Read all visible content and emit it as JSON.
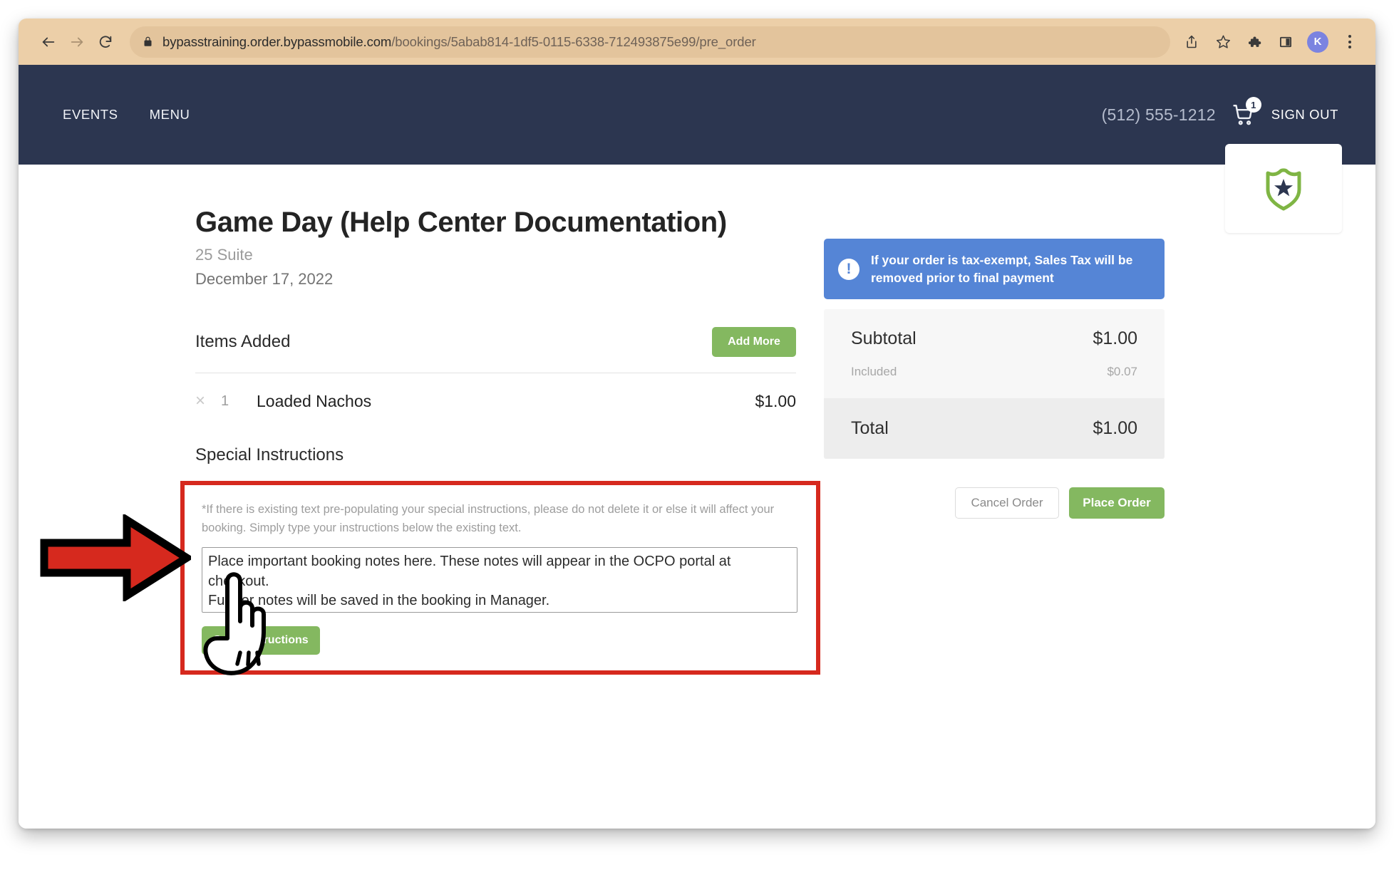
{
  "browser": {
    "url_secure_part": "bypasstraining.order.bypassmobile.com",
    "url_path": "/bookings/5abab814-1df5-0115-6338-712493875e99/pre_order",
    "back_label": "←",
    "forward_label": "→",
    "reload_label": "↻",
    "profile_initial": "K",
    "icons": {
      "lock": "lock-icon",
      "share": "share-icon",
      "bookmark": "star-icon",
      "extensions": "puzzle-icon",
      "sidebar": "sidebar-icon",
      "menu": "kebab-menu-icon"
    }
  },
  "site_header": {
    "nav": [
      {
        "label": "EVENTS"
      },
      {
        "label": "MENU"
      }
    ],
    "phone": "(512) 555-1212",
    "cart_count": "1",
    "sign_out": "SIGN OUT",
    "logo_alt": "shield-star-logo"
  },
  "event": {
    "title": "Game Day (Help Center Documentation)",
    "suite": "25 Suite",
    "date": "December 17, 2022"
  },
  "items_section": {
    "heading": "Items Added",
    "add_more_label": "Add More",
    "rows": [
      {
        "remove": "×",
        "qty": "1",
        "name": "Loaded Nachos",
        "price": "$1.00"
      }
    ]
  },
  "special_instructions": {
    "heading": "Special Instructions",
    "hint": "*If there is existing text pre-populating your special instructions, please do not delete it or else it will affect your booking. Simply type your instructions below the existing text.",
    "notes_value": "Place important booking notes here. These notes will appear in the OCPO portal at checkout.\nFurther notes will be saved in the booking in Manager.",
    "notes_placeholder": "",
    "save_label": "Save Instructions"
  },
  "order_summary": {
    "tax_banner": "If your order is tax-exempt, Sales Tax will be removed prior to final payment",
    "subtotal_label": "Subtotal",
    "subtotal_value": "$1.00",
    "included_label": "Included",
    "included_value": "$0.07",
    "total_label": "Total",
    "total_value": "$1.00",
    "cancel_label": "Cancel Order",
    "place_label": "Place Order"
  },
  "annotations": {
    "arrow": "red-arrow-pointing-right",
    "hand": "pointing-hand-cursor"
  },
  "colors": {
    "header_navy": "#2c3650",
    "accent_green": "#84b860",
    "banner_blue": "#5585d6",
    "highlight_red": "#d6291e",
    "toolbar_tan": "#eccfa8"
  }
}
